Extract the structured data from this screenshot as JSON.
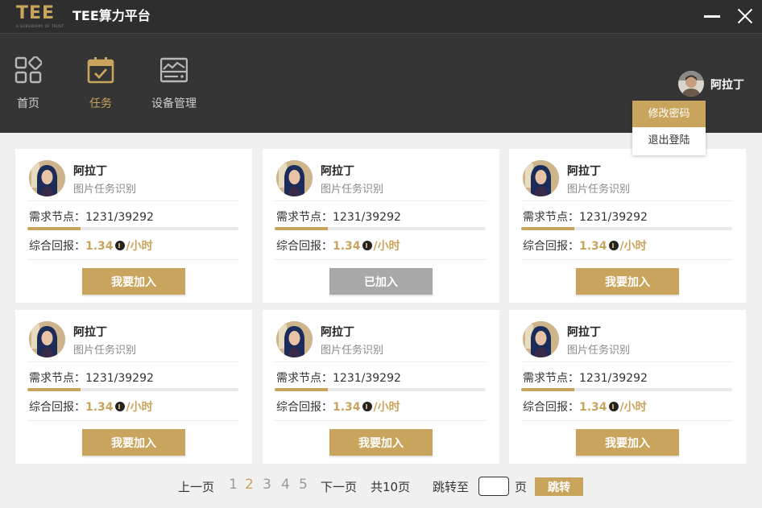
{
  "app": {
    "logo_text": "TEE",
    "logo_subtitle": "A SUBSIDIARY OF TRUST",
    "title": "TEE算力平台"
  },
  "nav": {
    "items": [
      {
        "label": "首页",
        "icon": "grid-icon",
        "active": false
      },
      {
        "label": "任务",
        "icon": "calendar-check-icon",
        "active": true
      },
      {
        "label": "设备管理",
        "icon": "server-icon",
        "active": false
      }
    ]
  },
  "user": {
    "name": "阿拉丁",
    "menu": [
      {
        "label": "修改密码",
        "active": true
      },
      {
        "label": "退出登陆",
        "active": false
      }
    ]
  },
  "cards": [
    {
      "name": "阿拉丁",
      "subtitle": "图片任务识别",
      "need_label": "需求节点：1231/39292",
      "progress": 0.25,
      "return_label": "综合回报：",
      "return_value": "1.34",
      "return_unit": "/小时",
      "button": "我要加入",
      "joined": false
    },
    {
      "name": "阿拉丁",
      "subtitle": "图片任务识别",
      "need_label": "需求节点：1231/39292",
      "progress": 0.25,
      "return_label": "综合回报：",
      "return_value": "1.34",
      "return_unit": "/小时",
      "button": "已加入",
      "joined": true
    },
    {
      "name": "阿拉丁",
      "subtitle": "图片任务识别",
      "need_label": "需求节点：1231/39292",
      "progress": 0.25,
      "return_label": "综合回报：",
      "return_value": "1.34",
      "return_unit": "/小时",
      "button": "我要加入",
      "joined": false
    },
    {
      "name": "阿拉丁",
      "subtitle": "图片任务识别",
      "need_label": "需求节点：1231/39292",
      "progress": 0.25,
      "return_label": "综合回报：",
      "return_value": "1.34",
      "return_unit": "/小时",
      "button": "我要加入",
      "joined": false
    },
    {
      "name": "阿拉丁",
      "subtitle": "图片任务识别",
      "need_label": "需求节点：1231/39292",
      "progress": 0.25,
      "return_label": "综合回报：",
      "return_value": "1.34",
      "return_unit": "/小时",
      "button": "我要加入",
      "joined": false
    },
    {
      "name": "阿拉丁",
      "subtitle": "图片任务识别",
      "need_label": "需求节点：1231/39292",
      "progress": 0.25,
      "return_label": "综合回报：",
      "return_value": "1.34",
      "return_unit": "/小时",
      "button": "我要加入",
      "joined": false
    }
  ],
  "pagination": {
    "prev": "上一页",
    "pages": [
      "1",
      "2",
      "3",
      "4",
      "5"
    ],
    "current": "2",
    "next": "下一页",
    "total": "共10页",
    "jump_label": "跳转至",
    "page_unit": "页",
    "jump_button": "跳转"
  },
  "colors": {
    "accent": "#c9a45c",
    "titlebar": "#2e2e2e",
    "navbar": "#353535",
    "joined": "#a8a8a8"
  }
}
